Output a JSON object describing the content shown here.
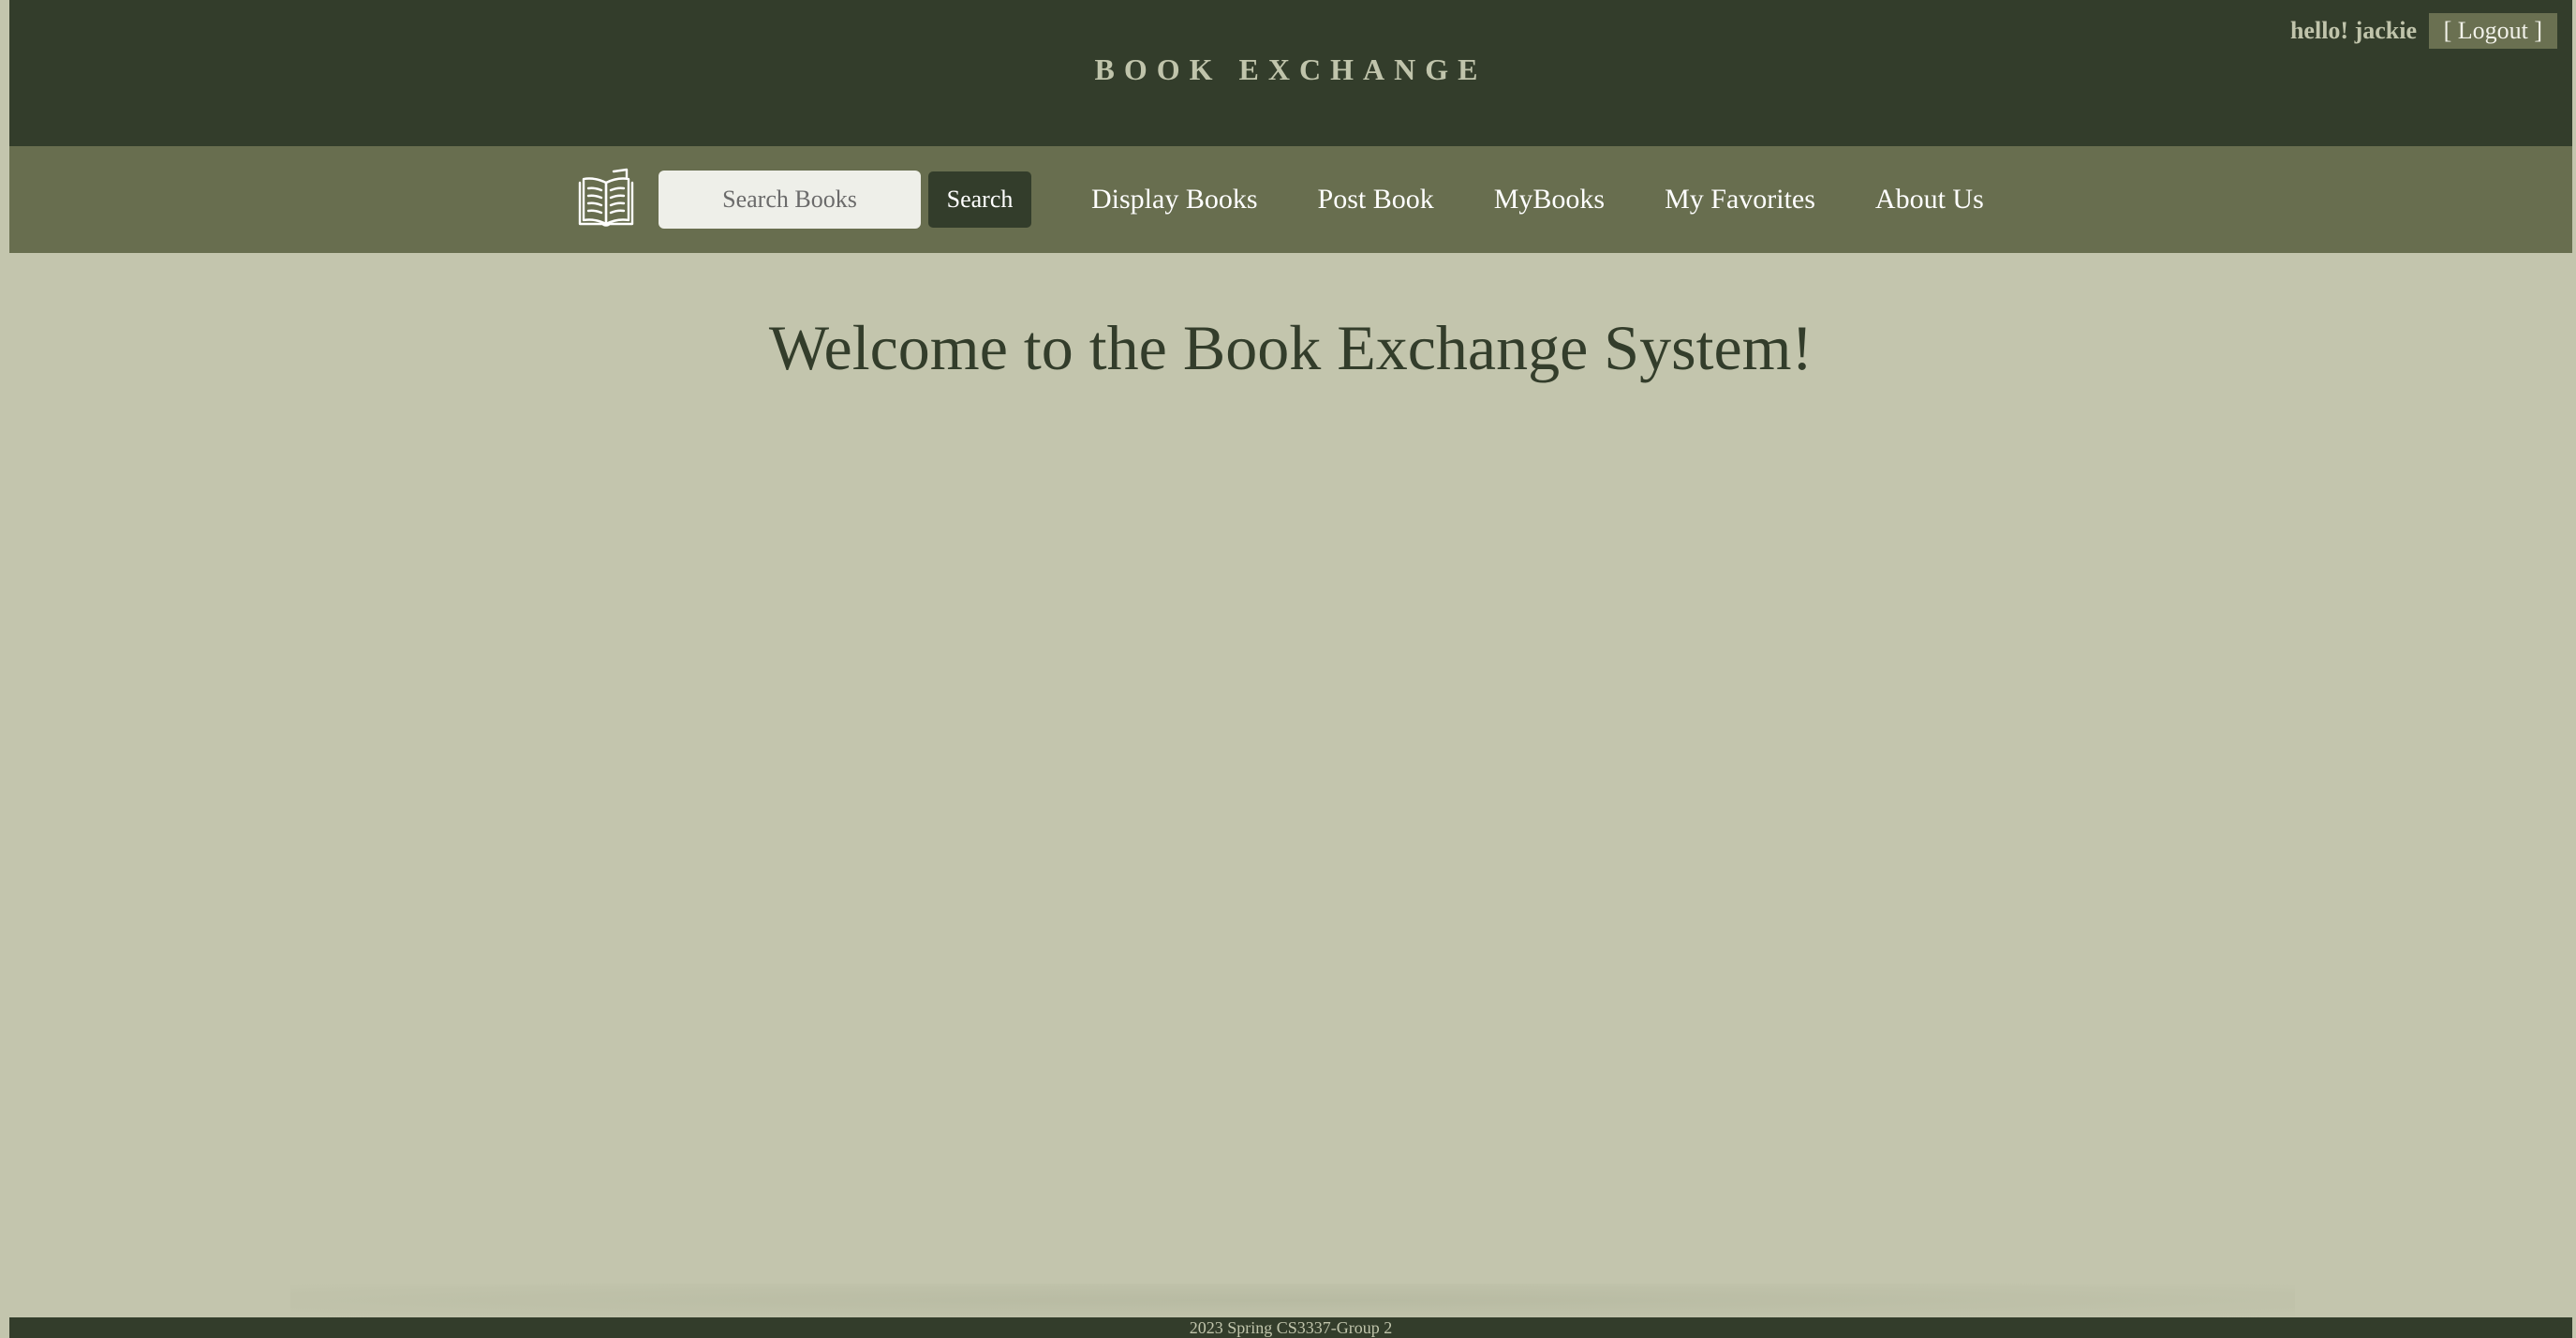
{
  "header": {
    "site_title": "BOOK EXCHANGE",
    "greeting": "hello! jackie",
    "logout_label": "[ Logout ]"
  },
  "navbar": {
    "logo_icon": "open-book-icon",
    "search": {
      "placeholder": "Search Books",
      "value": ""
    },
    "search_button_label": "Search",
    "links": [
      {
        "label": "Display Books"
      },
      {
        "label": "Post Book"
      },
      {
        "label": "MyBooks"
      },
      {
        "label": "My Favorites"
      },
      {
        "label": "About Us"
      }
    ]
  },
  "main": {
    "welcome_heading": "Welcome to the Book Exchange System!"
  },
  "footer": {
    "text": "2023 Spring CS3337-Group 2"
  },
  "colors": {
    "header_bg": "#333d2b",
    "navbar_bg": "#686e4f",
    "page_bg": "#c3c5ad",
    "title_text": "#c0c4ab"
  }
}
